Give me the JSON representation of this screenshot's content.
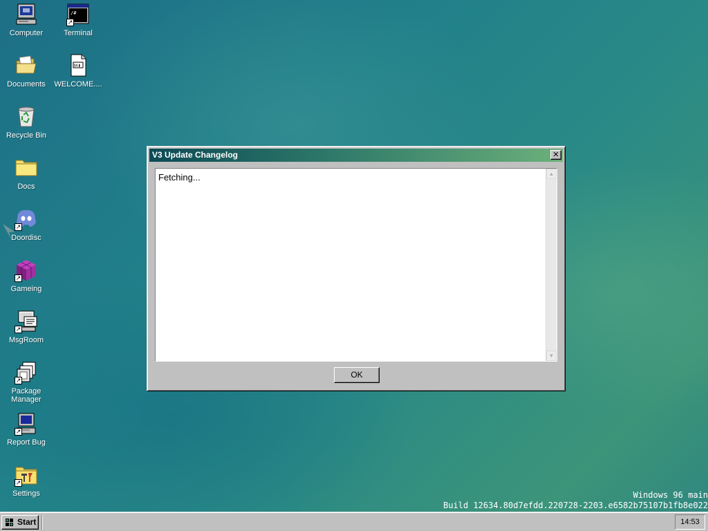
{
  "desktop": {
    "icons": [
      {
        "label": "Computer",
        "icon": "computer-icon"
      },
      {
        "label": "Terminal",
        "icon": "terminal-icon"
      },
      {
        "label": "Documents",
        "icon": "folder-open-icon"
      },
      {
        "label": "WELCOME....",
        "icon": "markdown-file-icon"
      },
      {
        "label": "Recycle Bin",
        "icon": "recycle-bin-icon"
      },
      {
        "label": "Docs",
        "icon": "folder-icon"
      },
      {
        "label": "Doordisc",
        "icon": "discord-icon"
      },
      {
        "label": "Gameing",
        "icon": "game-cube-icon"
      },
      {
        "label": "MsgRoom",
        "icon": "chat-icon"
      },
      {
        "label": "Package Manager",
        "icon": "package-icon"
      },
      {
        "label": "Report Bug",
        "icon": "report-bug-icon"
      },
      {
        "label": "Settings",
        "icon": "settings-icon"
      }
    ]
  },
  "dialog": {
    "title": "V3 Update Changelog",
    "content": "Fetching...",
    "ok_label": "OK"
  },
  "watermark": {
    "line1": "Windows 96 main",
    "line2": "Build 12634.80d7efdd.220728-2203.e6582b75107b1fb8e022"
  },
  "taskbar": {
    "start_label": "Start",
    "clock": "14:53"
  },
  "colors": {
    "desktop": "#21808a",
    "titlebar_start": "#0c4a55",
    "titlebar_end": "#6cb07a",
    "chrome": "#c0c0c0"
  }
}
